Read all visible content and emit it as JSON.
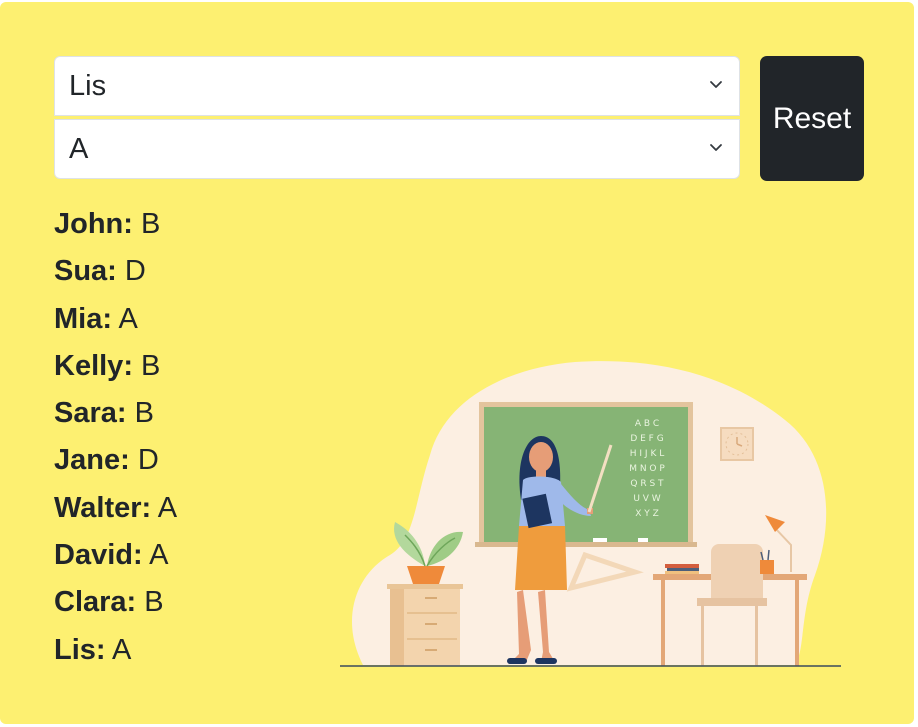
{
  "filters": {
    "name_select": {
      "selected": "Lis",
      "icon": "chevron-down-icon"
    },
    "grade_select": {
      "selected": "A",
      "icon": "chevron-down-icon"
    },
    "reset_label": "Reset"
  },
  "students": [
    {
      "name": "John:",
      "grade": "B"
    },
    {
      "name": "Sua:",
      "grade": "D"
    },
    {
      "name": "Mia:",
      "grade": "A"
    },
    {
      "name": "Kelly:",
      "grade": "B"
    },
    {
      "name": "Sara:",
      "grade": "B"
    },
    {
      "name": "Jane:",
      "grade": "D"
    },
    {
      "name": "Walter:",
      "grade": "A"
    },
    {
      "name": "David:",
      "grade": "A"
    },
    {
      "name": "Clara:",
      "grade": "B"
    },
    {
      "name": "Lis:",
      "grade": "A"
    }
  ],
  "illustration": {
    "chalkboard_letters": [
      "A B C",
      "D E F G",
      "H I J K L",
      "M N O P",
      "Q R S T",
      "U V W",
      "X Y Z"
    ]
  },
  "colors": {
    "panel_background": "#fdf071",
    "reset_button": "#212529",
    "chalkboard": "#86b475",
    "blob": "#fcefe2"
  }
}
